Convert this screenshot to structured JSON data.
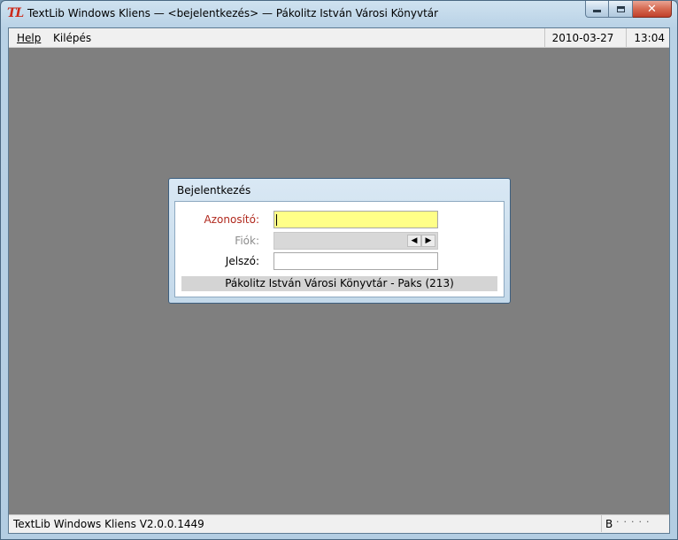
{
  "window": {
    "logo": "TL",
    "title": "TextLib Windows Kliens — <bejelentkezés> — Pákolitz István Városi Könyvtár"
  },
  "menubar": {
    "help": "Help",
    "exit": "Kilépés",
    "date": "2010-03-27",
    "time": "13:04"
  },
  "dialog": {
    "title": "Bejelentkezés",
    "username_label": "Azonosító:",
    "username_value": "",
    "branch_label": "Fiók:",
    "branch_value": "",
    "password_label": "Jelszó:",
    "password_value": "",
    "library": "Pákolitz István Városi Könyvtár - Paks (213)"
  },
  "statusbar": {
    "text": "TextLib Windows Kliens V2.0.0.1449",
    "indicator": "B",
    "dots": "·····"
  }
}
